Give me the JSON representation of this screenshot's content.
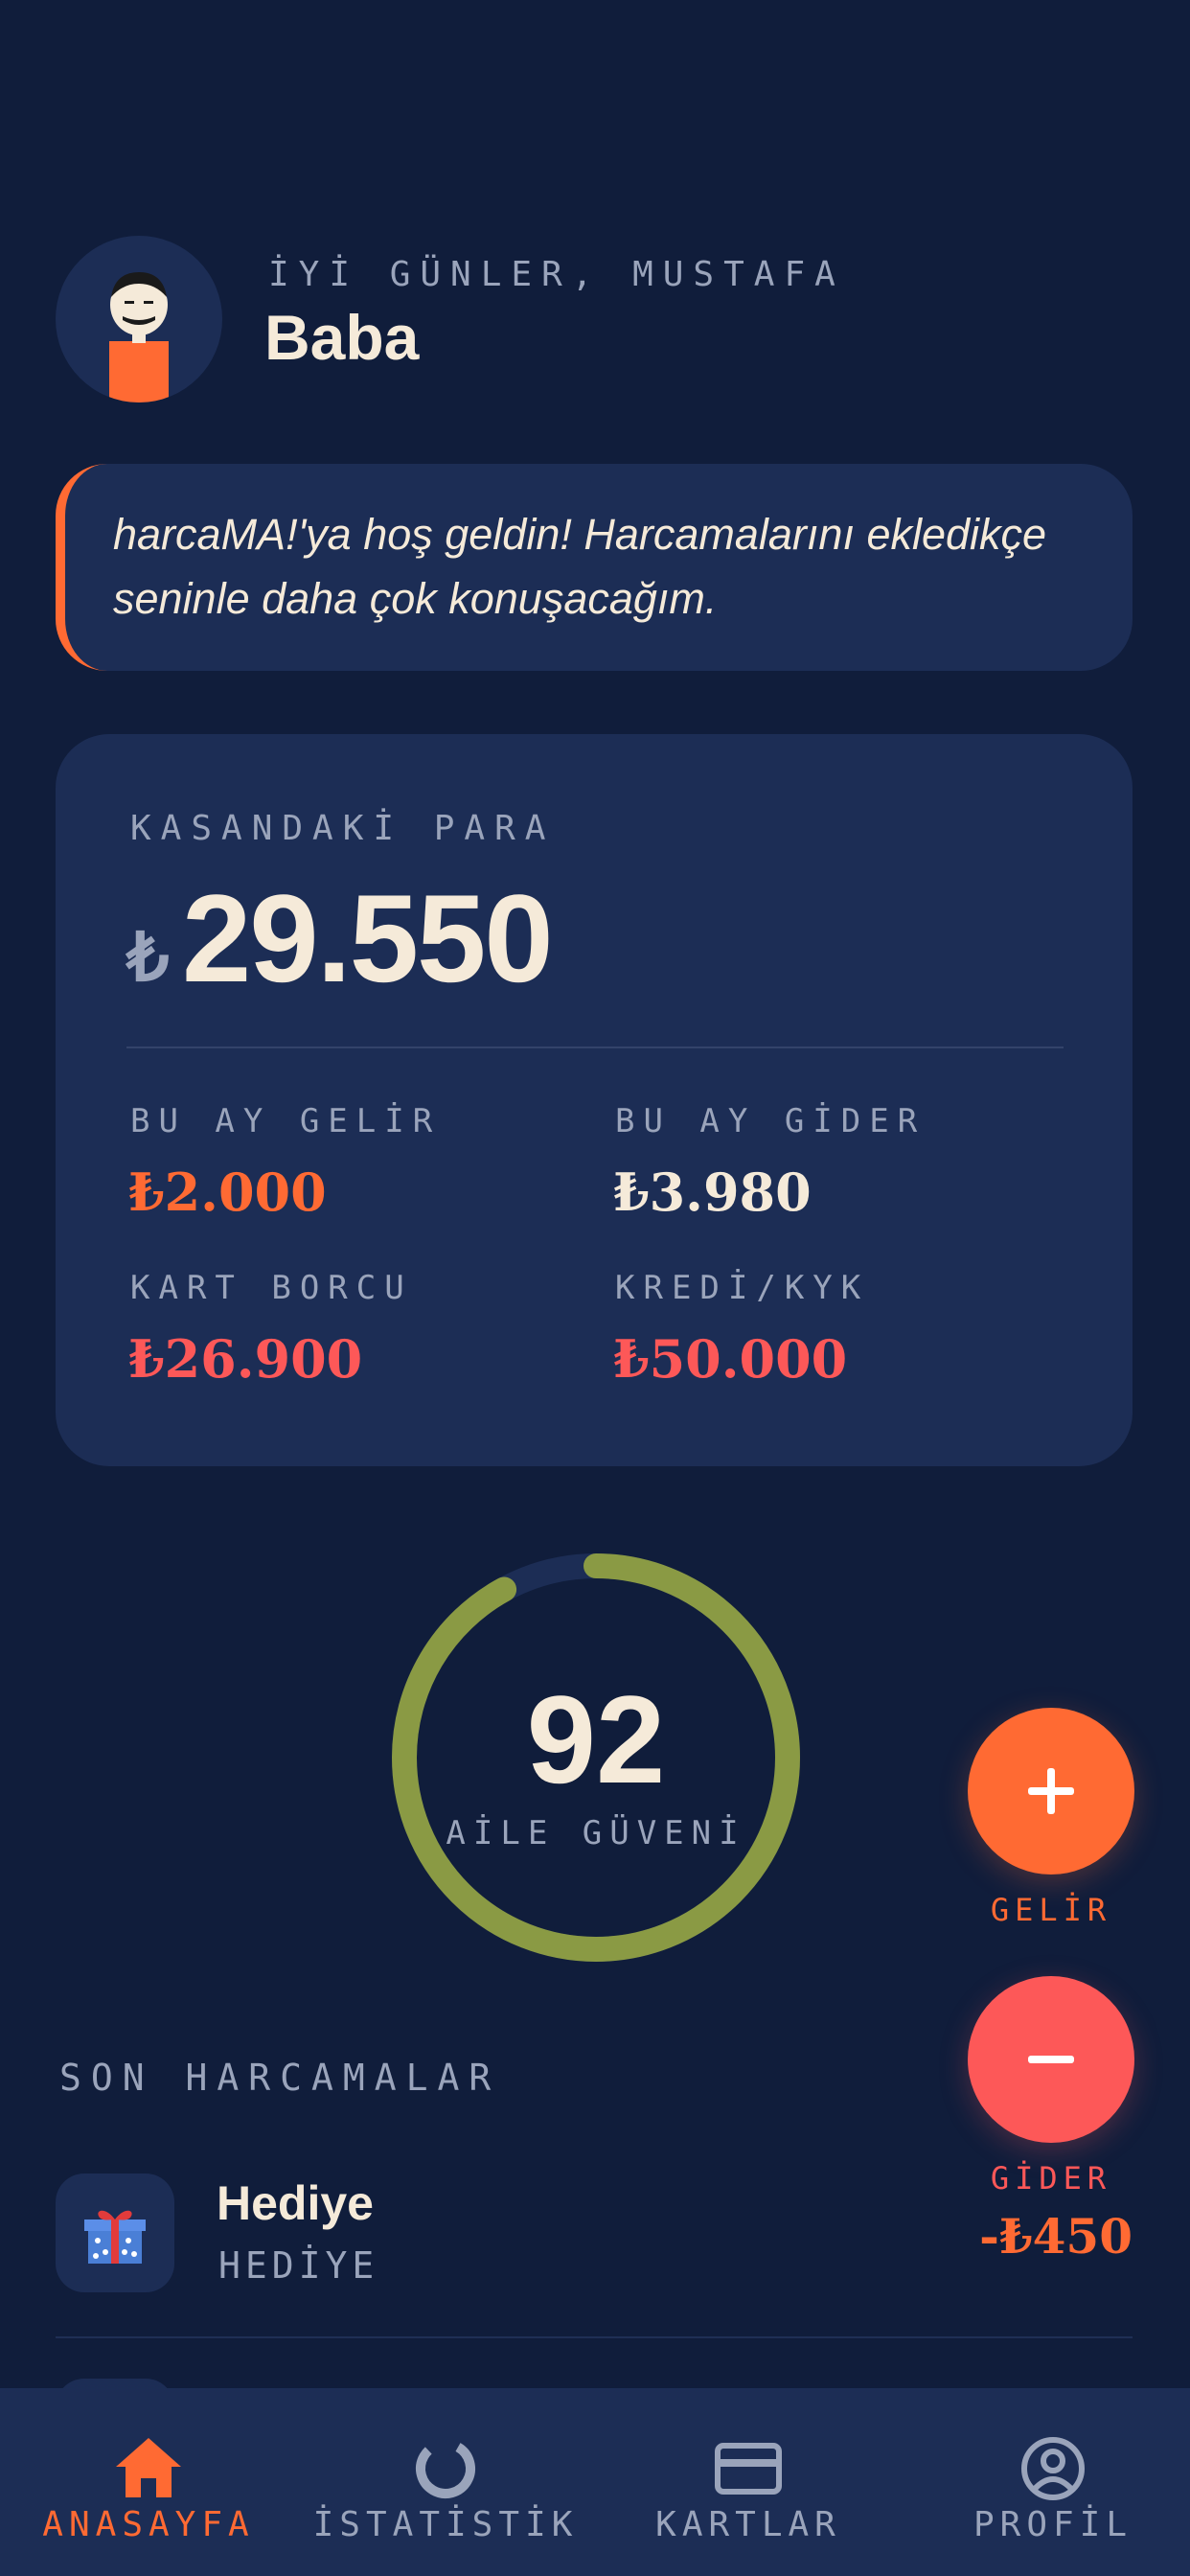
{
  "header": {
    "greeting": "İYİ GÜNLER, MUSTAFA",
    "username": "Baba"
  },
  "welcome": {
    "message": "harcaMA!'ya hoş geldin! Harcamalarını ekledikçe seninle daha çok konuşacağım."
  },
  "balance_card": {
    "label": "KASANDAKİ PARA",
    "currency_symbol": "₺",
    "amount": "29.550",
    "stats": [
      {
        "label": "BU AY GELİR",
        "value": "₺2.000",
        "color": "#ff6a33"
      },
      {
        "label": "BU AY GİDER",
        "value": "₺3.980",
        "color": "#f5ead9"
      },
      {
        "label": "KART BORCU",
        "value": "₺26.900",
        "color": "#fd5858"
      },
      {
        "label": "KREDİ/KYK",
        "value": "₺50.000",
        "color": "#fd5858"
      }
    ]
  },
  "trust_score": {
    "value": "92",
    "label": "AİLE GÜVENİ",
    "progress": 0.92,
    "color": "#8a9a44"
  },
  "actions": {
    "income_label": "GELİR",
    "income_icon": "plus-icon",
    "expense_label": "GİDER",
    "expense_icon": "minus-icon"
  },
  "recent": {
    "title": "SON HARCAMALAR",
    "items": [
      {
        "title": "Hediye",
        "category": "HEDİYE",
        "amount": "-₺450",
        "icon": "gift-icon"
      }
    ]
  },
  "nav": {
    "items": [
      {
        "label": "ANASAYFA",
        "icon": "home-icon",
        "active": true
      },
      {
        "label": "İSTATİSTİK",
        "icon": "chart-ring-icon",
        "active": false
      },
      {
        "label": "KARTLAR",
        "icon": "card-icon",
        "active": false
      },
      {
        "label": "PROFİL",
        "icon": "profile-icon",
        "active": false
      }
    ]
  },
  "colors": {
    "background": "#101d3b",
    "surface": "#1c2d55",
    "accent": "#ff6a33",
    "danger": "#fd5858",
    "text": "#f5ead9",
    "muted": "#9aa4bb"
  }
}
